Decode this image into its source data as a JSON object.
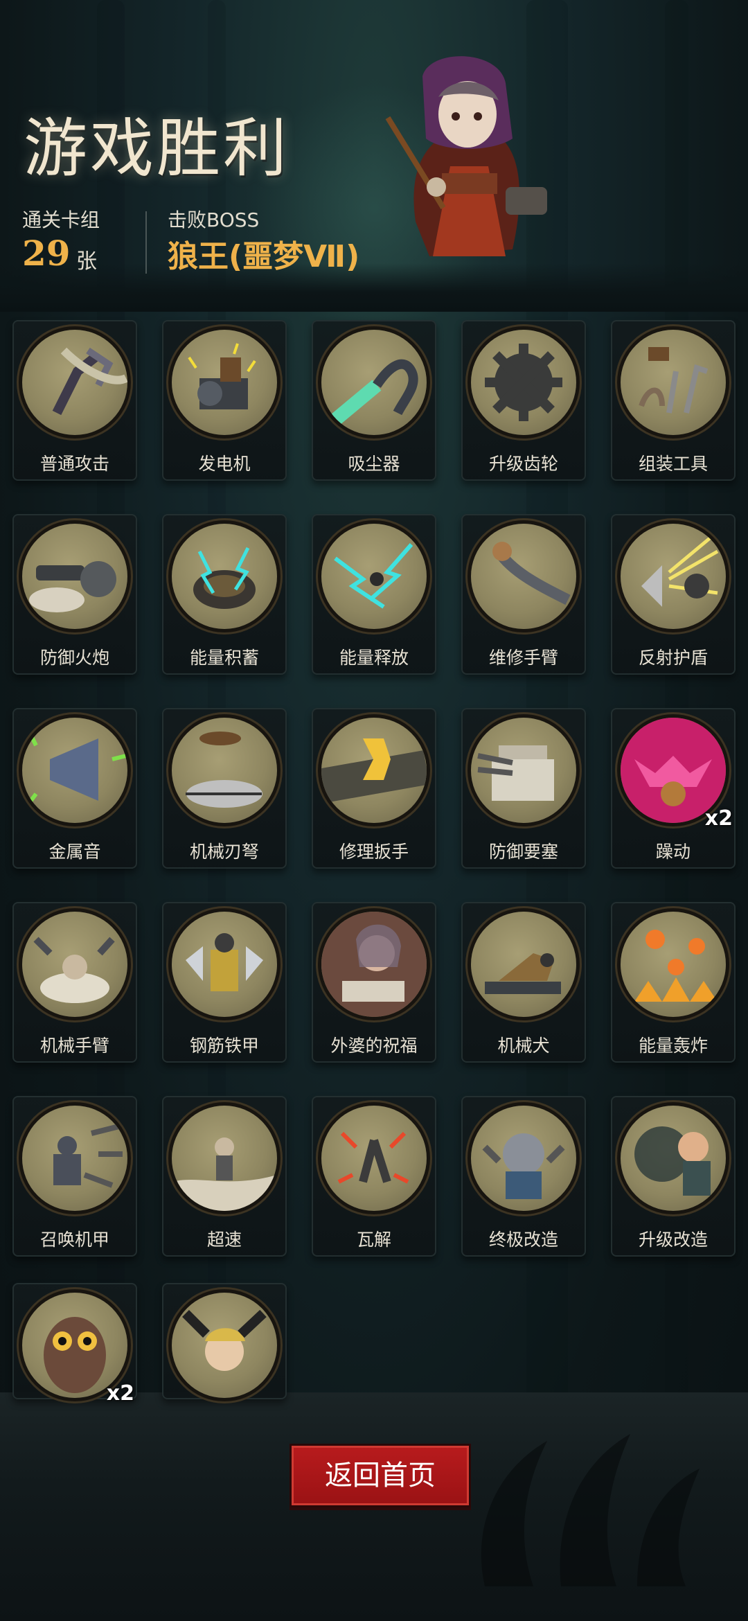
{
  "header": {
    "title": "游戏胜利",
    "deck_label": "通关卡组",
    "deck_count": "29",
    "deck_unit": "张",
    "boss_label": "击败BOSS",
    "boss_name": "狼王(噩梦Ⅶ)"
  },
  "cards": [
    {
      "label": "普通攻击",
      "icon": "claw-arm-icon",
      "multiplier": ""
    },
    {
      "label": "发电机",
      "icon": "generator-icon",
      "multiplier": ""
    },
    {
      "label": "吸尘器",
      "icon": "vacuum-icon",
      "multiplier": ""
    },
    {
      "label": "升级齿轮",
      "icon": "gear-icon",
      "multiplier": ""
    },
    {
      "label": "组装工具",
      "icon": "tools-icon",
      "multiplier": ""
    },
    {
      "label": "防御火炮",
      "icon": "cannon-icon",
      "multiplier": ""
    },
    {
      "label": "能量积蓄",
      "icon": "energy-dome-icon",
      "multiplier": ""
    },
    {
      "label": "能量释放",
      "icon": "lightning-icon",
      "multiplier": ""
    },
    {
      "label": "维修手臂",
      "icon": "repair-arm-icon",
      "multiplier": ""
    },
    {
      "label": "反射护盾",
      "icon": "shield-icon",
      "multiplier": ""
    },
    {
      "label": "金属音",
      "icon": "megaphone-icon",
      "multiplier": ""
    },
    {
      "label": "机械刃弩",
      "icon": "crossbow-icon",
      "multiplier": ""
    },
    {
      "label": "修理扳手",
      "icon": "wrench-icon",
      "multiplier": ""
    },
    {
      "label": "防御要塞",
      "icon": "fortress-icon",
      "multiplier": ""
    },
    {
      "label": "躁动",
      "icon": "frenzy-icon",
      "multiplier": "x2"
    },
    {
      "label": "机械手臂",
      "icon": "mech-arms-icon",
      "multiplier": ""
    },
    {
      "label": "钢筋铁甲",
      "icon": "armor-icon",
      "multiplier": ""
    },
    {
      "label": "外婆的祝福",
      "icon": "grandma-icon",
      "multiplier": ""
    },
    {
      "label": "机械犬",
      "icon": "mech-dog-icon",
      "multiplier": ""
    },
    {
      "label": "能量轰炸",
      "icon": "fireball-icon",
      "multiplier": ""
    },
    {
      "label": "召唤机甲",
      "icon": "summon-mech-icon",
      "multiplier": ""
    },
    {
      "label": "超速",
      "icon": "speed-icon",
      "multiplier": ""
    },
    {
      "label": "瓦解",
      "icon": "collapse-icon",
      "multiplier": ""
    },
    {
      "label": "终极改造",
      "icon": "ultimate-mod-icon",
      "multiplier": ""
    },
    {
      "label": "升级改造",
      "icon": "upgrade-mod-icon",
      "multiplier": ""
    },
    {
      "label": "",
      "icon": "owl-icon",
      "multiplier": "x2"
    },
    {
      "label": "",
      "icon": "scared-kid-icon",
      "multiplier": ""
    }
  ],
  "footer": {
    "home_button": "返回首页"
  },
  "colors": {
    "accent": "#efb24a",
    "button_red": "#b81b1d",
    "disc": "#a79e74"
  }
}
